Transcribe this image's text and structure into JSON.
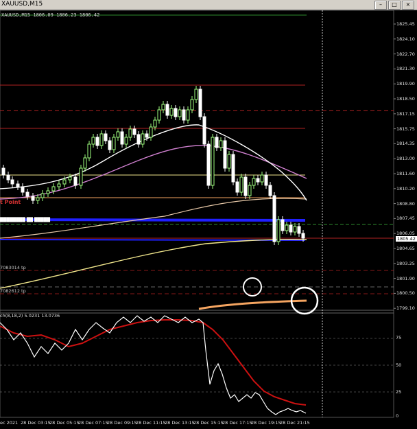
{
  "window": {
    "title": "XAUUSD,M15",
    "buttons": [
      "–",
      "□",
      "×"
    ]
  },
  "info_line": "XAUUSD,M15 1806.09 1806.23 1806.42",
  "price_axis": [
    "1825.45",
    "1824.10",
    "1822.70",
    "1821.30",
    "1819.90",
    "1818.50",
    "1817.15",
    "1815.75",
    "1814.35",
    "1813.00",
    "1811.60",
    "1810.20",
    "1808.80",
    "1807.45",
    "1806.05",
    "1804.65",
    "1803.25",
    "1801.90",
    "1800.50",
    "1799.10"
  ],
  "current_price": "1805.42",
  "labels": {
    "pivot": "t Point",
    "tp1": "7083014 tp",
    "tp2": "7082612 tp",
    "blue_text": "████████ ██ █████",
    "stoch": "ch(8,18,2) 5.0231 13.0736"
  },
  "stoch_axis": [
    "75",
    "50",
    "25",
    "0"
  ],
  "time_axis": [
    "ec 2021",
    "28 Dec 03:15",
    "28 Dec 05:15",
    "28 Dec 07:15",
    "28 Dec 09:15",
    "28 Dec 11:15",
    "28 Dec 13:15",
    "28 Dec 15:15",
    "28 Dec 17:15",
    "28 Dec 19:15",
    "28 Dec 21:15"
  ],
  "colors": {
    "bull": "#a0ff80",
    "bear": "#ffffff",
    "stoch_main": "#ffffff",
    "stoch_signal": "#cc1111",
    "ma_white": "#ffffff",
    "ma_violet": "#d080d0",
    "ma_yellow": "#f0e68c",
    "ma_orange": "#f4a460"
  }
}
